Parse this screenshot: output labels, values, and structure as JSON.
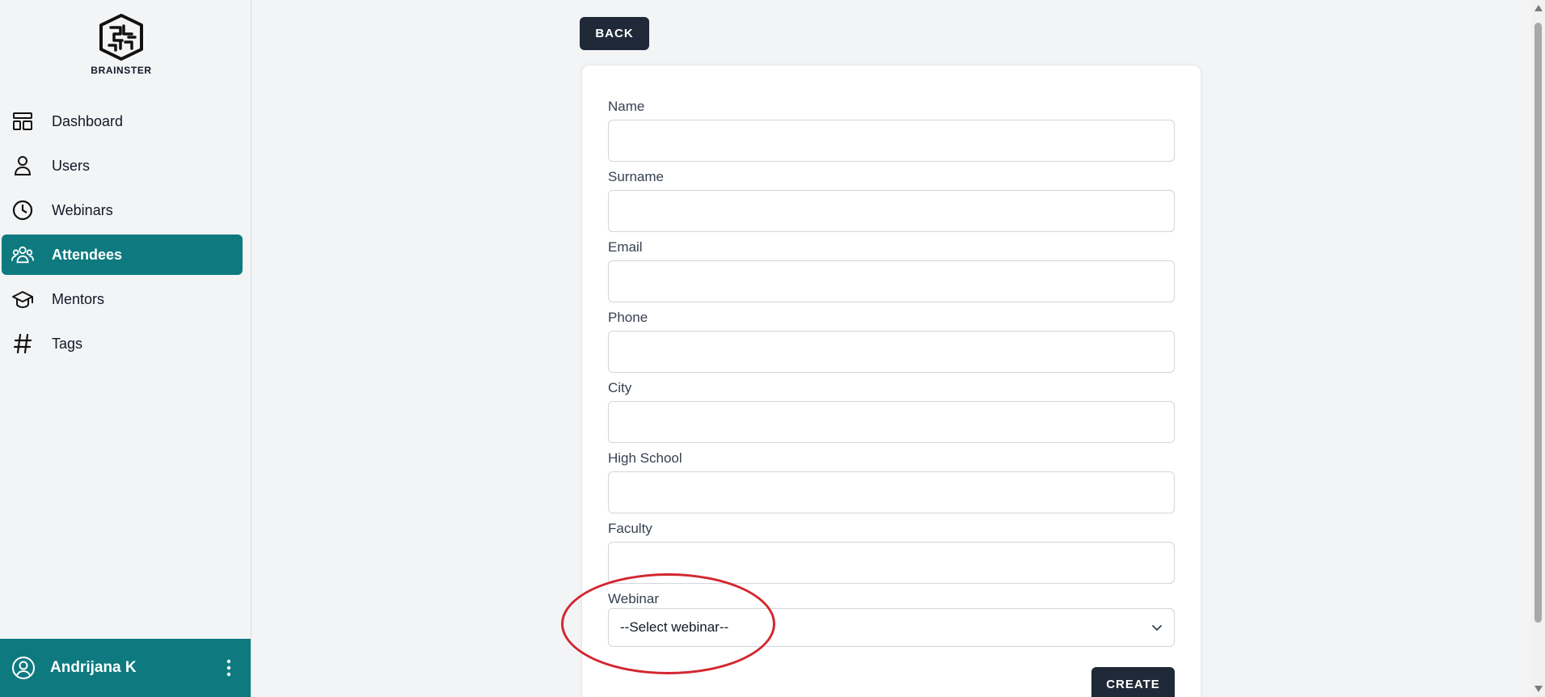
{
  "brand": {
    "name": "BRAINSTER",
    "icon": "brain-logo-icon"
  },
  "sidebar": {
    "items": [
      {
        "label": "Dashboard",
        "icon": "dashboard-icon",
        "active": false
      },
      {
        "label": "Users",
        "icon": "user-icon",
        "active": false
      },
      {
        "label": "Webinars",
        "icon": "clock-icon",
        "active": false
      },
      {
        "label": "Attendees",
        "icon": "people-group-icon",
        "active": true
      },
      {
        "label": "Mentors",
        "icon": "graduation-cap-icon",
        "active": false
      },
      {
        "label": "Tags",
        "icon": "hashtag-icon",
        "active": false
      }
    ],
    "user": {
      "name": "Andrijana K",
      "icon": "user-circle-icon",
      "menu_icon": "kebab-menu-icon"
    }
  },
  "colors": {
    "accent": "#0e7a80",
    "button": "#1f2937",
    "highlight": "#d22730"
  },
  "main": {
    "back_label": "BACK",
    "form": {
      "fields": [
        {
          "label": "Name",
          "value": "",
          "placeholder": ""
        },
        {
          "label": "Surname",
          "value": "",
          "placeholder": ""
        },
        {
          "label": "Email",
          "value": "",
          "placeholder": ""
        },
        {
          "label": "Phone",
          "value": "",
          "placeholder": ""
        },
        {
          "label": "City",
          "value": "",
          "placeholder": ""
        },
        {
          "label": "High School",
          "value": "",
          "placeholder": ""
        },
        {
          "label": "Faculty",
          "value": "",
          "placeholder": ""
        }
      ],
      "webinar": {
        "label": "Webinar",
        "selected": "--Select webinar--"
      },
      "submit_label": "CREATE"
    }
  }
}
